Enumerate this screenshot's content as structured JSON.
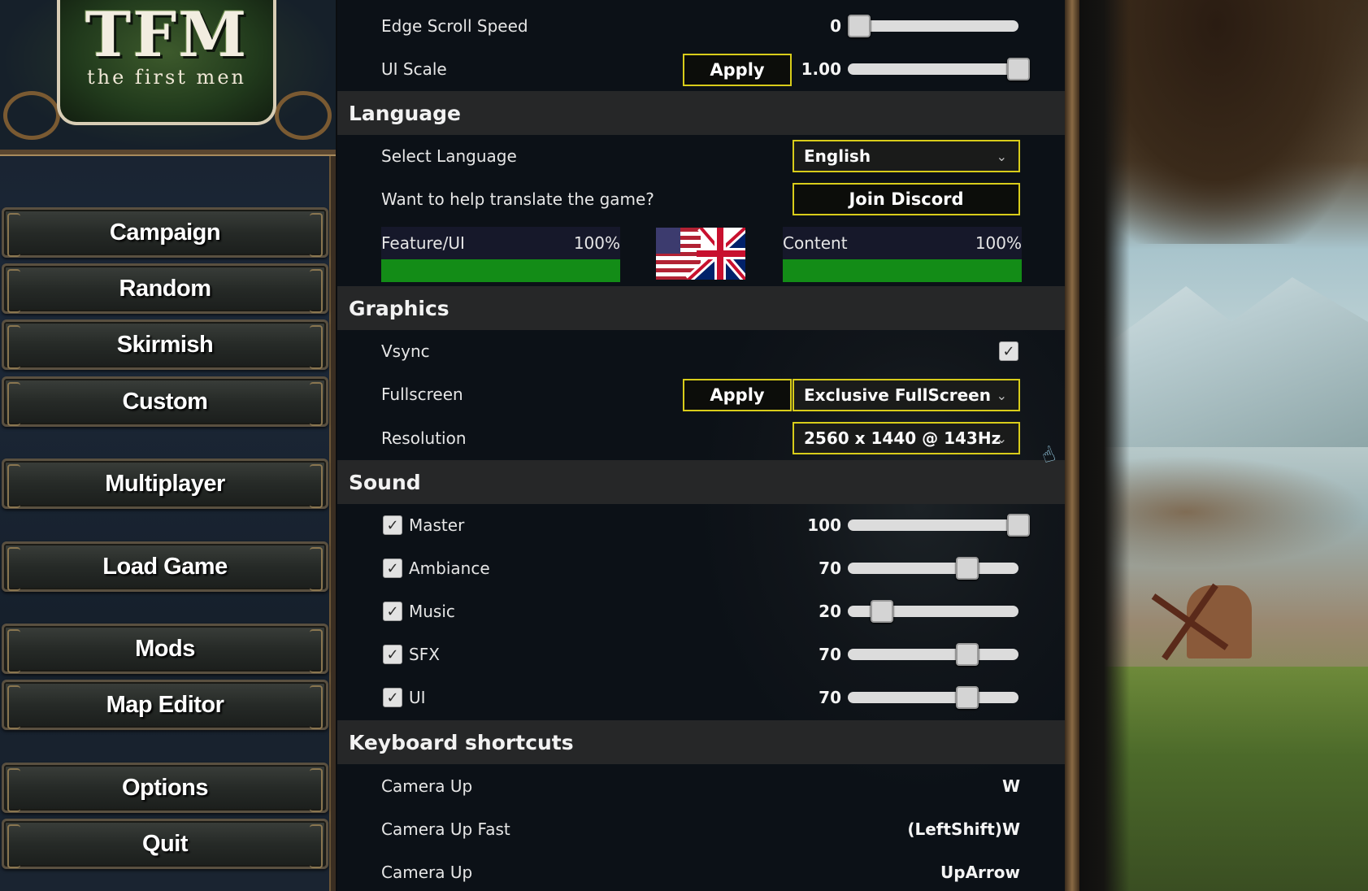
{
  "logo": {
    "title": "TFM",
    "subtitle": "the first men"
  },
  "menu": {
    "items": [
      {
        "label": "Campaign"
      },
      {
        "label": "Random"
      },
      {
        "label": "Skirmish"
      },
      {
        "label": "Custom"
      },
      {
        "label": "Multiplayer"
      },
      {
        "label": "Load Game"
      },
      {
        "label": "Mods"
      },
      {
        "label": "Map Editor"
      },
      {
        "label": "Options"
      },
      {
        "label": "Quit"
      }
    ]
  },
  "settings": {
    "edge_scroll": {
      "label": "Edge Scroll Speed",
      "value": "0",
      "level": 0
    },
    "ui_scale": {
      "label": "UI Scale",
      "apply_label": "Apply",
      "value": "1.00",
      "level": 1
    },
    "language": {
      "header": "Language",
      "select_label": "Select Language",
      "selected": "English",
      "translate_label": "Want to help translate the game?",
      "discord_label": "Join Discord",
      "feature_label": "Feature/UI",
      "feature_pct": "100%",
      "feature_level": 1,
      "content_label": "Content",
      "content_pct": "100%",
      "content_level": 1
    },
    "graphics": {
      "header": "Graphics",
      "vsync_label": "Vsync",
      "vsync_checked": true,
      "fullscreen_label": "Fullscreen",
      "fullscreen_apply_label": "Apply",
      "fullscreen_value": "Exclusive FullScreen",
      "resolution_label": "Resolution",
      "resolution_value": "2560 x 1440 @ 143Hz"
    },
    "sound": {
      "header": "Sound",
      "channels": [
        {
          "label": "Master",
          "value": "100",
          "level": 1.0,
          "checked": true
        },
        {
          "label": "Ambiance",
          "value": "70",
          "level": 0.7,
          "checked": true
        },
        {
          "label": "Music",
          "value": "20",
          "level": 0.2,
          "checked": true
        },
        {
          "label": "SFX",
          "value": "70",
          "level": 0.7,
          "checked": true
        },
        {
          "label": "UI",
          "value": "70",
          "level": 0.7,
          "checked": true
        }
      ]
    },
    "keyboard": {
      "header": "Keyboard shortcuts",
      "shortcuts": [
        {
          "label": "Camera Up",
          "key": "W"
        },
        {
          "label": "Camera Up Fast",
          "key": "(LeftShift)W"
        },
        {
          "label": "Camera Up",
          "key": "UpArrow"
        }
      ]
    }
  },
  "icons": {
    "check": "✓",
    "chevron": "⌄",
    "cursor": "☝"
  },
  "colors": {
    "accent_border": "#d8cc1a",
    "progress_fill": "#138c17",
    "section_bg": "#262728",
    "panel_bg": "#0c1117"
  }
}
